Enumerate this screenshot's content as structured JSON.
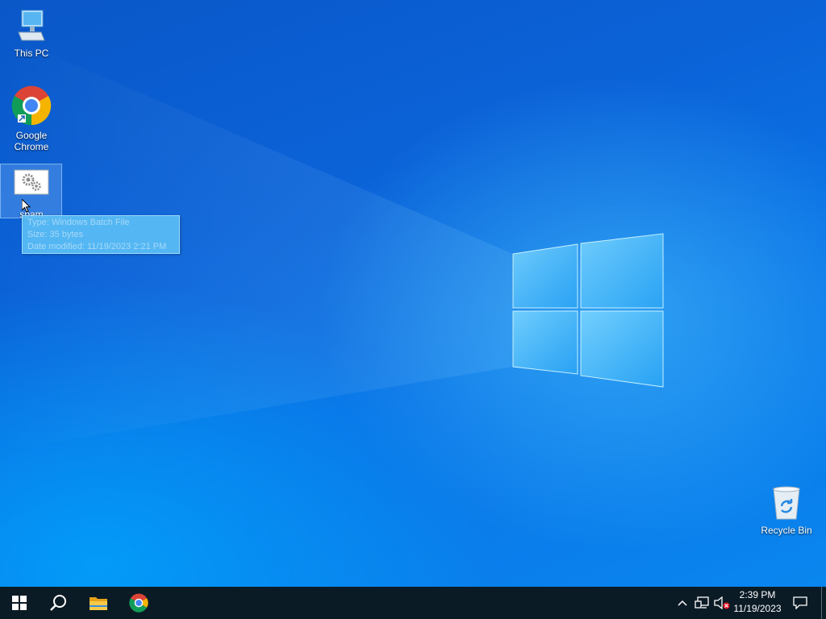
{
  "desktop": {
    "icons": [
      {
        "label": "This PC",
        "icon": "this-pc-icon"
      },
      {
        "label": "Google\nChrome",
        "line1": "Google",
        "line2": "Chrome",
        "icon": "chrome-icon"
      },
      {
        "label": "spam",
        "icon": "batch-file-icon"
      },
      {
        "label": "Recycle Bin",
        "icon": "recycle-bin-icon"
      }
    ]
  },
  "tooltip": {
    "type": "Type: Windows Batch File",
    "size": "Size: 35 bytes",
    "modified": "Date modified: 11/19/2023 2:21 PM"
  },
  "taskbar": {
    "buttons": [
      "start-icon",
      "search-icon",
      "file-explorer-icon",
      "chrome-icon"
    ],
    "tray": {
      "time": "2:39 PM",
      "date": "11/19/2023",
      "icons": [
        "chevron-up-icon",
        "network-icon",
        "volume-muted-icon",
        "notification-icon"
      ]
    }
  },
  "colors": {
    "taskbar": "#0b1b26",
    "wallpaper": "#0a6fe0"
  }
}
